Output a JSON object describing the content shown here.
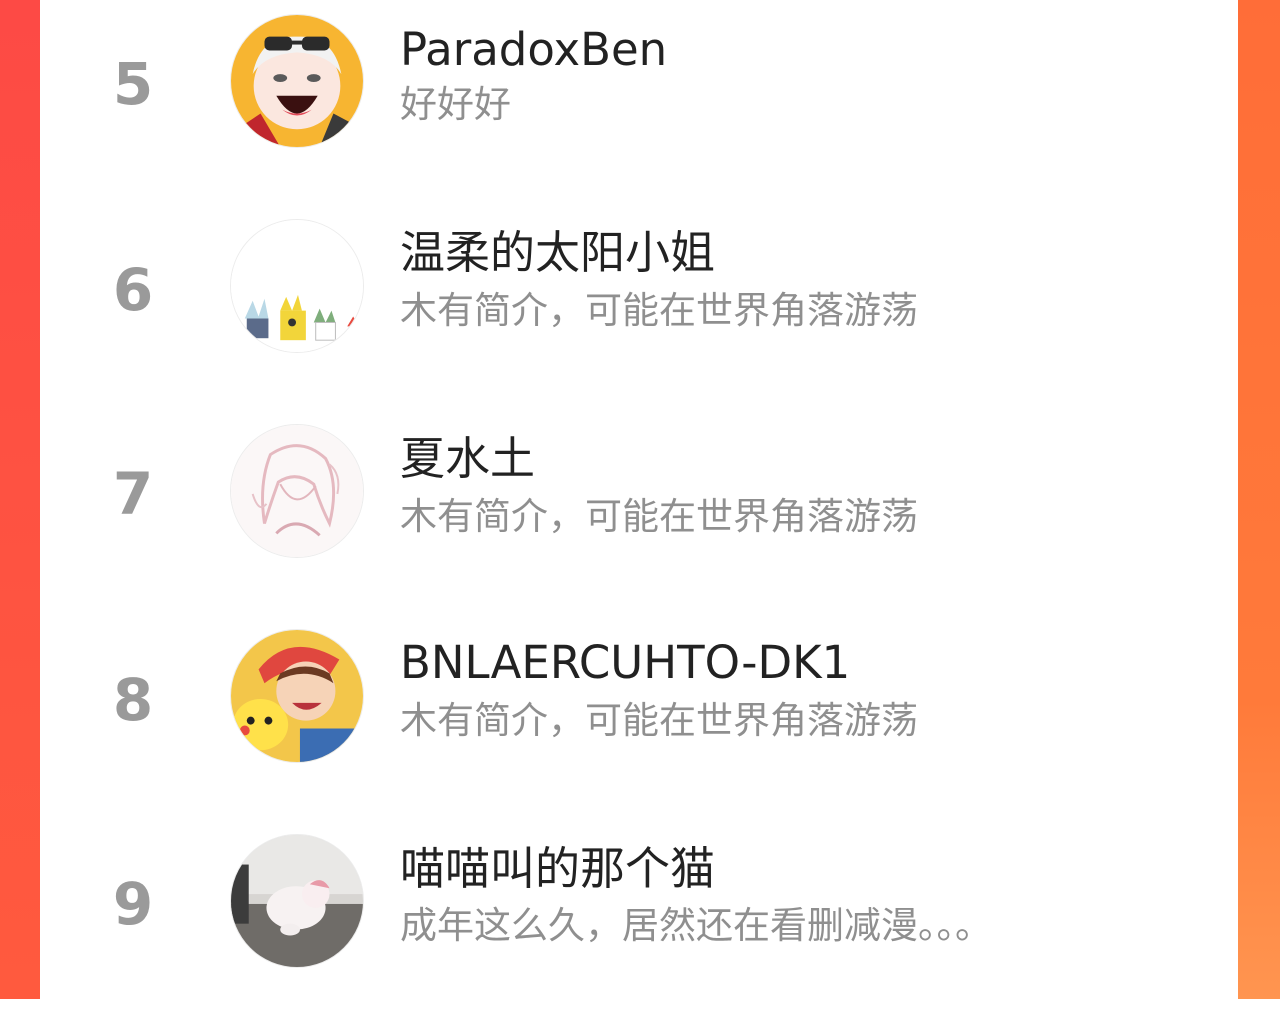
{
  "colors": {
    "rank": "#9a9a9a",
    "name": "#222222",
    "bio": "#8f8f8f",
    "accent_left": "#fd4a45",
    "accent_right": "#ff7a3a"
  },
  "ranking": {
    "items": [
      {
        "rank": "5",
        "name": "ParadoxBen",
        "bio": "好好好",
        "avatar_icon": "anime-character-sunglasses-avatar"
      },
      {
        "rank": "6",
        "name": "温柔的太阳小姐",
        "bio": "木有简介，可能在世界角落游荡",
        "avatar_icon": "succulent-plants-avatar"
      },
      {
        "rank": "7",
        "name": "夏水土",
        "bio": "木有简介，可能在世界角落游荡",
        "avatar_icon": "sketch-anime-girl-avatar"
      },
      {
        "rank": "8",
        "name": "BNLAERCUHTO-DK1",
        "bio": "木有简介，可能在世界角落游荡",
        "avatar_icon": "pikachu-trainer-avatar"
      },
      {
        "rank": "9",
        "name": "喵喵叫的那个猫",
        "bio": "成年这么久，居然还在看删减漫。。。",
        "avatar_icon": "white-dog-photo-avatar"
      }
    ]
  }
}
